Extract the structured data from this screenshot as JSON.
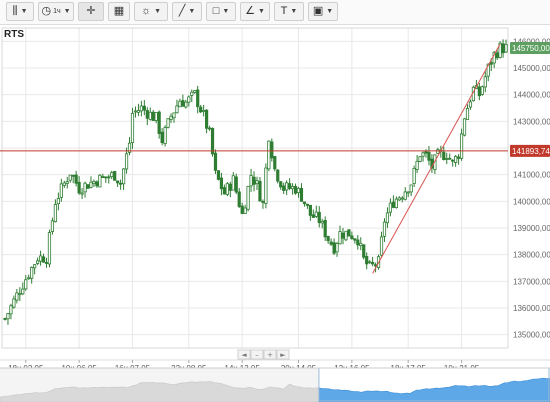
{
  "toolbar": {
    "buttons": [
      {
        "name": "chart-type-button",
        "icon": "candlestick-icon",
        "glyph": "⫼",
        "has_dropdown": true
      },
      {
        "name": "interval-button",
        "icon": "clock-icon",
        "glyph": "◷",
        "label": "1ч",
        "has_dropdown": true
      },
      {
        "name": "crosshair-button",
        "icon": "crosshair-icon",
        "glyph": "✛",
        "has_dropdown": false,
        "active": true
      },
      {
        "name": "calendar-button",
        "icon": "calendar-icon",
        "glyph": "▦",
        "has_dropdown": false
      },
      {
        "name": "indicators-button",
        "icon": "sun-icon",
        "glyph": "☼",
        "has_dropdown": true
      },
      {
        "name": "draw-line-button",
        "icon": "pencil-line-icon",
        "glyph": "╱",
        "has_dropdown": true
      },
      {
        "name": "shapes-button",
        "icon": "square-icon",
        "glyph": "□",
        "has_dropdown": true
      },
      {
        "name": "fib-button",
        "icon": "angle-chart-icon",
        "glyph": "∠",
        "has_dropdown": true
      },
      {
        "name": "text-button",
        "icon": "text-icon",
        "glyph": "T",
        "has_dropdown": true
      },
      {
        "name": "image-button",
        "icon": "image-icon",
        "glyph": "▣",
        "has_dropdown": true
      }
    ]
  },
  "chart_data": {
    "type": "candlestick",
    "title": "RTS",
    "ylim": [
      134500,
      146500
    ],
    "yticks": [
      "135000,00",
      "136000,00",
      "137000,00",
      "138000,00",
      "139000,00",
      "140000,00",
      "141000,00",
      "142000,00",
      "143000,00",
      "144000,00",
      "145000,00",
      "146000,00"
    ],
    "ytick_values": [
      135000,
      136000,
      137000,
      138000,
      139000,
      140000,
      141000,
      142000,
      143000,
      144000,
      145000,
      146000
    ],
    "xtick_labels": [
      {
        "label": "18ч 02.05",
        "bar": 7
      },
      {
        "label": "10ч 06.05",
        "bar": 25
      },
      {
        "label": "16ч 07.05",
        "bar": 43
      },
      {
        "label": "22ч 08.05",
        "bar": 62
      },
      {
        "label": "14ч 13.05",
        "bar": 80
      },
      {
        "label": "20ч 14.05",
        "bar": 99
      },
      {
        "label": "12ч 16.05",
        "bar": 117
      },
      {
        "label": "18ч 17.05",
        "bar": 136
      },
      {
        "label": "10ч 21.05",
        "bar": 154
      }
    ],
    "n_bars": 170,
    "anchors": [
      [
        0,
        135600
      ],
      [
        5,
        136700
      ],
      [
        11,
        137900
      ],
      [
        14,
        137900
      ],
      [
        17,
        140000
      ],
      [
        22,
        141100
      ],
      [
        25,
        140500
      ],
      [
        31,
        140800
      ],
      [
        37,
        141000
      ],
      [
        39,
        140700
      ],
      [
        42,
        142200
      ],
      [
        43,
        143300
      ],
      [
        46,
        143500
      ],
      [
        51,
        143100
      ],
      [
        53,
        142300
      ],
      [
        56,
        143200
      ],
      [
        59,
        143800
      ],
      [
        61,
        143700
      ],
      [
        64,
        144000
      ],
      [
        67,
        143200
      ],
      [
        69,
        142500
      ],
      [
        71,
        141000
      ],
      [
        74,
        140300
      ],
      [
        77,
        140800
      ],
      [
        80,
        139500
      ],
      [
        83,
        141000
      ],
      [
        85,
        140600
      ],
      [
        87,
        139900
      ],
      [
        89,
        142500
      ],
      [
        91,
        141200
      ],
      [
        94,
        140500
      ],
      [
        98,
        140500
      ],
      [
        100,
        140200
      ],
      [
        103,
        139500
      ],
      [
        106,
        139300
      ],
      [
        109,
        138600
      ],
      [
        111,
        138300
      ],
      [
        113,
        138800
      ],
      [
        116,
        138800
      ],
      [
        119,
        138600
      ],
      [
        121,
        137800
      ],
      [
        123,
        137500
      ],
      [
        126,
        137700
      ],
      [
        128,
        139300
      ],
      [
        131,
        140000
      ],
      [
        134,
        140300
      ],
      [
        137,
        140700
      ],
      [
        140,
        141800
      ],
      [
        142,
        141700
      ],
      [
        144,
        141300
      ],
      [
        146,
        141700
      ],
      [
        149,
        141800
      ],
      [
        151,
        141400
      ],
      [
        153,
        141800
      ],
      [
        155,
        143200
      ],
      [
        158,
        144200
      ],
      [
        160,
        144000
      ],
      [
        163,
        145000
      ],
      [
        165,
        145500
      ],
      [
        167,
        145750
      ]
    ],
    "current_price": {
      "value": 145750,
      "label": "145750,00",
      "color": "#5d9f61"
    },
    "horizontal_line": {
      "value": 141893.74,
      "label": "141893,74",
      "color": "#c0392b"
    },
    "trend_line": {
      "from": {
        "bar": 124,
        "value": 137300
      },
      "to": {
        "bar": 167,
        "value": 145900
      },
      "color": "#d9534f"
    },
    "candle_color": "#2e7d32",
    "grid": true,
    "navigator": {
      "buttons": [
        "◄",
        "–",
        "+",
        "►"
      ],
      "selection": {
        "from_bar": 98,
        "to_bar": 170
      }
    }
  }
}
